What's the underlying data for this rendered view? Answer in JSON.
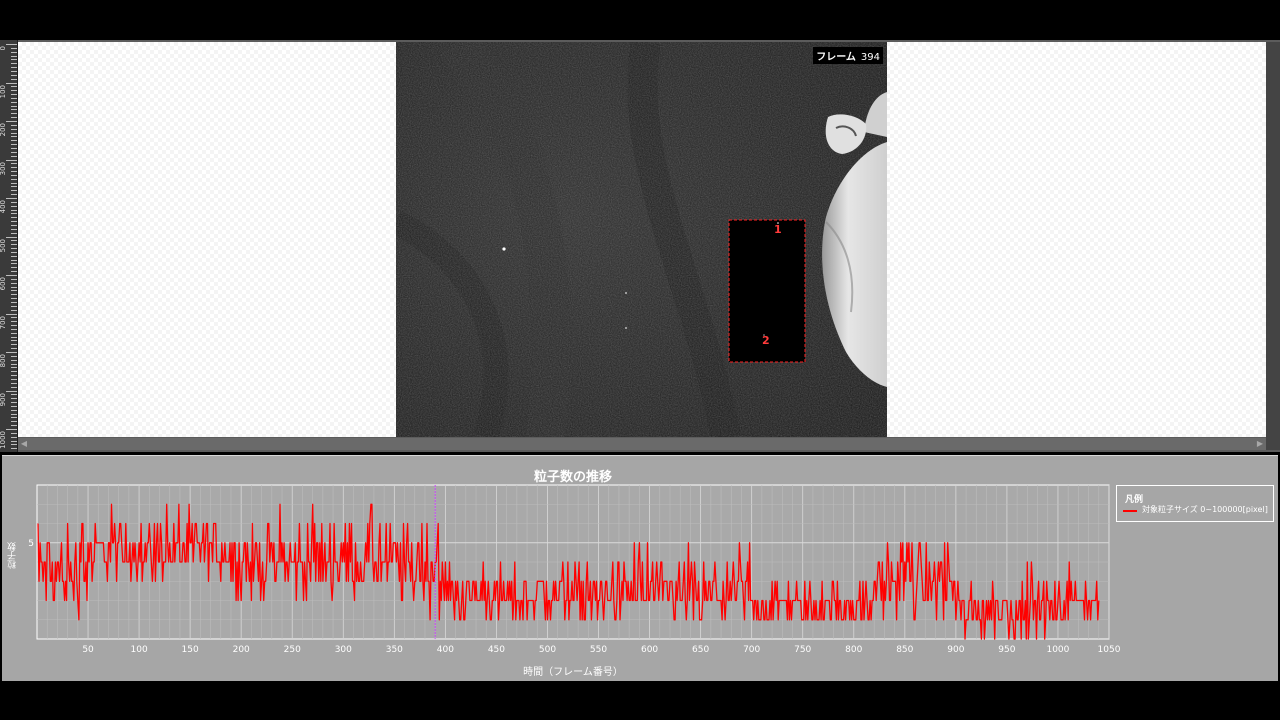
{
  "viewer": {
    "frame_label": "フレーム",
    "frame_number": "394",
    "ruler_labels": [
      "0",
      "100",
      "200",
      "300",
      "400",
      "500",
      "600",
      "700",
      "800",
      "900",
      "1000"
    ],
    "roi": {
      "labels": [
        "1",
        "2"
      ],
      "color": "#ff2020"
    }
  },
  "chart_data": {
    "type": "line",
    "title": "粒子数の推移",
    "xlabel": "時間（フレーム番号）",
    "ylabel": "粒子数",
    "xlim": [
      0,
      1050
    ],
    "ylim": [
      0,
      8
    ],
    "x_ticks": [
      50,
      100,
      150,
      200,
      250,
      300,
      350,
      400,
      450,
      500,
      550,
      600,
      650,
      700,
      750,
      800,
      850,
      900,
      950,
      1000,
      1050
    ],
    "y_ticks": [
      5
    ],
    "grid": true,
    "current_frame": 390,
    "current_frame_color": "#cc44ff",
    "legend": {
      "title": "凡例",
      "placement": "right",
      "entries": [
        {
          "name": "対象粒子サイズ 0~100000[pixel]",
          "color": "#ff0000"
        }
      ]
    },
    "series": [
      {
        "name": "対象粒子サイズ 0~100000[pixel]",
        "color": "#ff0000",
        "segments": [
          {
            "x_start": 1,
            "x_end": 50,
            "mean": 3.4,
            "spread": 1.3,
            "min": 0,
            "max": 6
          },
          {
            "x_start": 50,
            "x_end": 190,
            "mean": 4.6,
            "spread": 1.1,
            "min": 3,
            "max": 7
          },
          {
            "x_start": 190,
            "x_end": 270,
            "mean": 4.0,
            "spread": 1.2,
            "min": 2,
            "max": 7
          },
          {
            "x_start": 270,
            "x_end": 340,
            "mean": 4.2,
            "spread": 1.3,
            "min": 2,
            "max": 7
          },
          {
            "x_start": 340,
            "x_end": 395,
            "mean": 3.9,
            "spread": 1.5,
            "min": 1,
            "max": 8
          },
          {
            "x_start": 395,
            "x_end": 560,
            "mean": 2.2,
            "spread": 0.9,
            "min": 1,
            "max": 4
          },
          {
            "x_start": 560,
            "x_end": 700,
            "mean": 2.2,
            "spread": 1.1,
            "min": 0,
            "max": 5
          },
          {
            "x_start": 700,
            "x_end": 820,
            "mean": 1.7,
            "spread": 0.7,
            "min": 1,
            "max": 3
          },
          {
            "x_start": 820,
            "x_end": 900,
            "mean": 3.0,
            "spread": 1.2,
            "min": 1,
            "max": 5
          },
          {
            "x_start": 900,
            "x_end": 1000,
            "mean": 1.6,
            "spread": 0.9,
            "min": 0,
            "max": 4
          },
          {
            "x_start": 1000,
            "x_end": 1040,
            "mean": 2.0,
            "spread": 0.8,
            "min": 0,
            "max": 4
          }
        ],
        "last_value": 2
      }
    ]
  }
}
